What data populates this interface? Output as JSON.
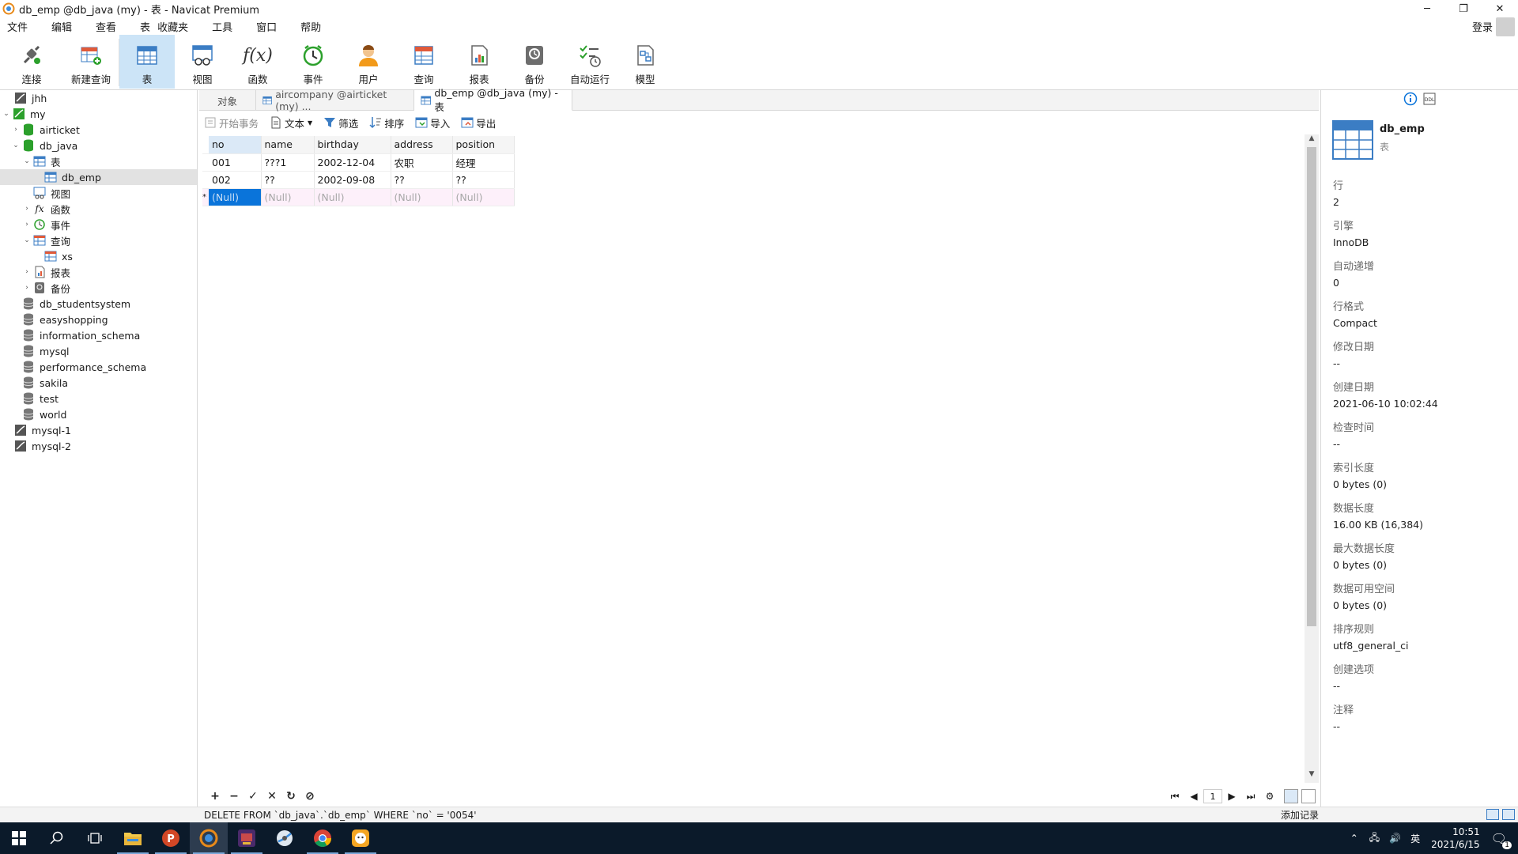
{
  "window": {
    "title": "db_emp @db_java (my) - 表 - Navicat Premium",
    "controls": {
      "minimize": "─",
      "restore": "❐",
      "close": "✕"
    }
  },
  "menu": {
    "items": [
      "文件",
      "编辑",
      "查看",
      "表",
      "收藏夹",
      "工具",
      "窗口",
      "帮助"
    ],
    "login": "登录"
  },
  "toolbar": {
    "buttons": [
      {
        "label": "连接",
        "icon": "connect-icon"
      },
      {
        "label": "新建查询",
        "icon": "new-query-icon"
      },
      {
        "label": "表",
        "icon": "table-icon",
        "active": true
      },
      {
        "label": "视图",
        "icon": "view-icon"
      },
      {
        "label": "函数",
        "icon": "function-icon"
      },
      {
        "label": "事件",
        "icon": "event-clock-icon"
      },
      {
        "label": "用户",
        "icon": "user-icon"
      },
      {
        "label": "查询",
        "icon": "query-icon"
      },
      {
        "label": "报表",
        "icon": "report-icon"
      },
      {
        "label": "备份",
        "icon": "backup-icon"
      },
      {
        "label": "自动运行",
        "icon": "automation-icon"
      },
      {
        "label": "模型",
        "icon": "model-icon"
      }
    ],
    "function_glyph": "f(x)"
  },
  "tree": {
    "conn_jhh": "jhh",
    "conn_my": "my",
    "db_airticket": "airticket",
    "db_java": "db_java",
    "node_tables": "表",
    "table_db_emp": "db_emp",
    "node_views": "视图",
    "node_functions": "函数",
    "node_events": "事件",
    "node_queries": "查询",
    "query_xs": "xs",
    "node_reports": "报表",
    "node_backups": "备份",
    "db_studentsystem": "db_studentsystem",
    "db_easyshopping": "easyshopping",
    "db_information_schema": "information_schema",
    "db_mysql": "mysql",
    "db_performance_schema": "performance_schema",
    "db_sakila": "sakila",
    "db_test": "test",
    "db_world": "world",
    "conn_mysql1": "mysql-1",
    "conn_mysql2": "mysql-2"
  },
  "tabs": {
    "objects": "对象",
    "aircompany": "aircompany @airticket (my) ...",
    "db_emp": "db_emp @db_java (my) - 表"
  },
  "subtoolbar": {
    "begin_tx": "开始事务",
    "text": "文本",
    "filter": "筛选",
    "sort": "排序",
    "import": "导入",
    "export": "导出"
  },
  "table": {
    "columns": [
      "no",
      "name",
      "birthday",
      "address",
      "position"
    ],
    "rows": [
      [
        "001",
        "???1",
        "2002-12-04",
        "农职",
        "经理"
      ],
      [
        "002",
        "??",
        "2002-09-08",
        "??",
        "??"
      ]
    ],
    "new_row": [
      "(Null)",
      "(Null)",
      "(Null)",
      "(Null)",
      "(Null)"
    ],
    "new_row_marker": "*"
  },
  "grid_nav": {
    "page": "1"
  },
  "info": {
    "name": "db_emp",
    "type": "表",
    "props": [
      {
        "k": "行",
        "v": "2"
      },
      {
        "k": "引擎",
        "v": "InnoDB"
      },
      {
        "k": "自动递增",
        "v": "0"
      },
      {
        "k": "行格式",
        "v": "Compact"
      },
      {
        "k": "修改日期",
        "v": "--"
      },
      {
        "k": "创建日期",
        "v": "2021-06-10 10:02:44"
      },
      {
        "k": "检查时间",
        "v": "--"
      },
      {
        "k": "索引长度",
        "v": "0 bytes (0)"
      },
      {
        "k": "数据长度",
        "v": "16.00 KB (16,384)"
      },
      {
        "k": "最大数据长度",
        "v": "0 bytes (0)"
      },
      {
        "k": "数据可用空间",
        "v": "0 bytes (0)"
      },
      {
        "k": "排序规则",
        "v": "utf8_general_ci"
      },
      {
        "k": "创建选项",
        "v": "--"
      },
      {
        "k": "注释",
        "v": "--"
      }
    ],
    "ddl_label": "DDL"
  },
  "status": {
    "sql": "DELETE FROM `db_java`.`db_emp` WHERE `no` = '0054'",
    "right": "添加记录"
  },
  "taskbar": {
    "ime": "英",
    "time": "10:51",
    "date": "2021/6/15",
    "notify_count": "1"
  },
  "colors": {
    "accent": "#0a74da",
    "selection": "#cce4f7",
    "db_green": "#2ca02c",
    "taskbar": "#0b1a2a"
  }
}
